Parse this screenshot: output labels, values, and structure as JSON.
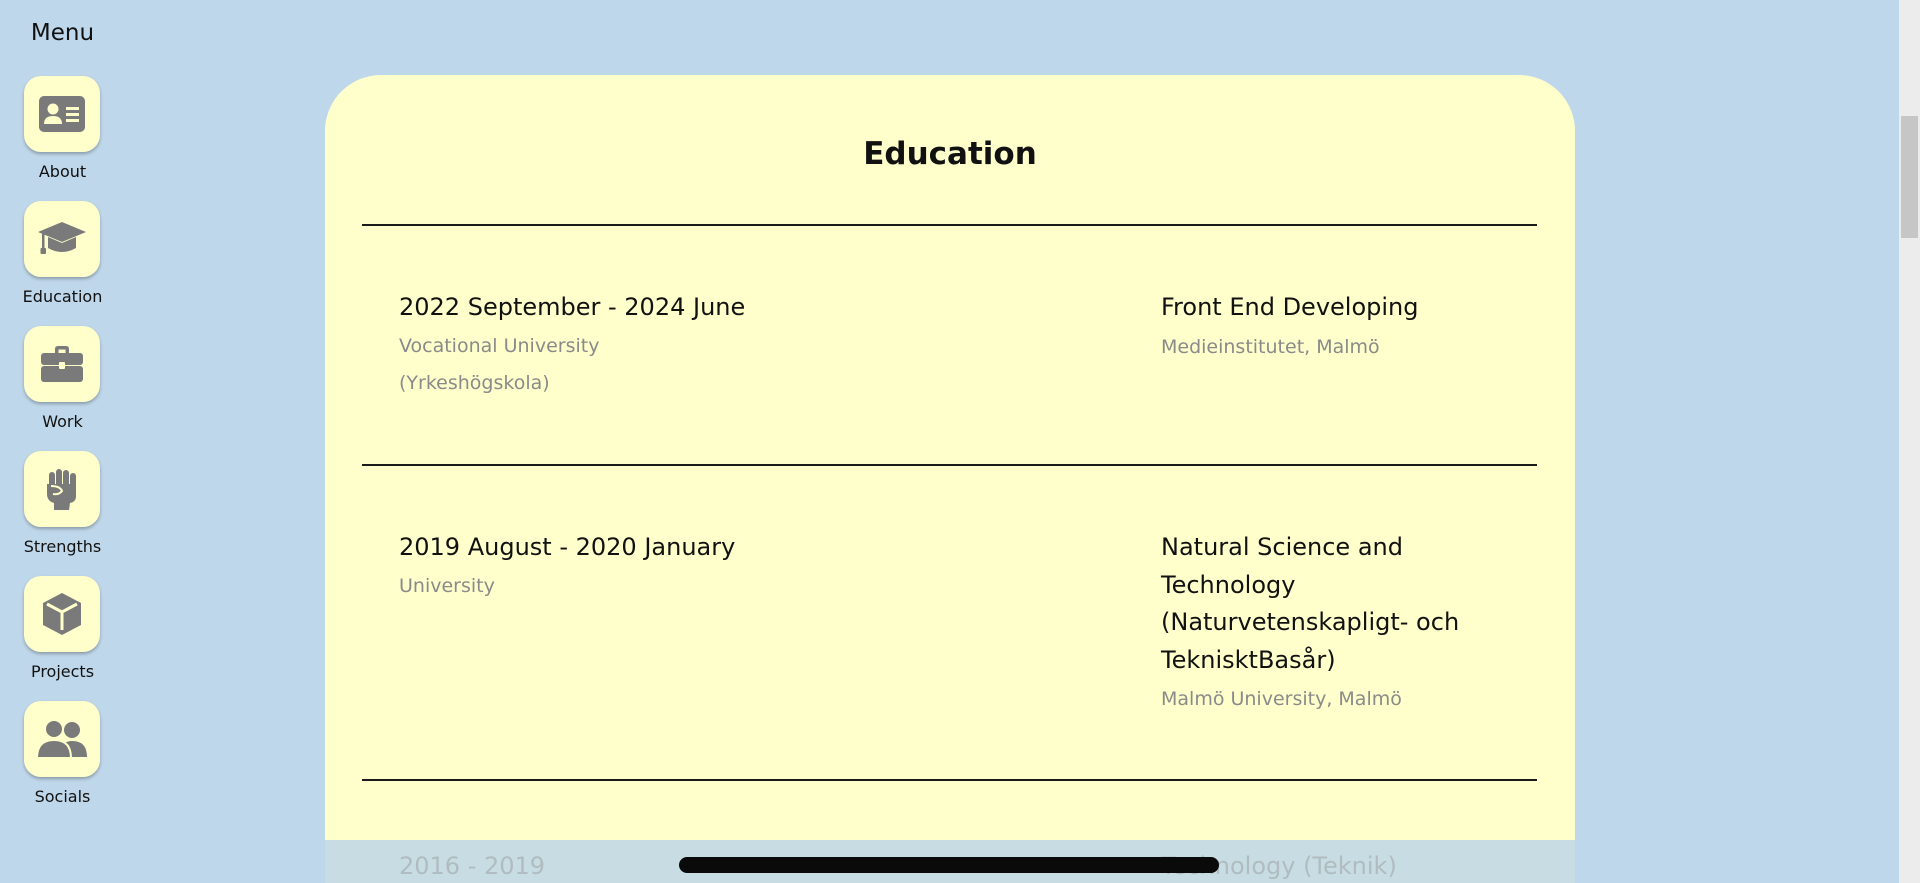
{
  "sidebar": {
    "title": "Menu",
    "items": [
      {
        "label": "About",
        "icon": "id-card-icon"
      },
      {
        "label": "Education",
        "icon": "graduation-cap-icon"
      },
      {
        "label": "Work",
        "icon": "briefcase-icon"
      },
      {
        "label": "Strengths",
        "icon": "fist-icon"
      },
      {
        "label": "Projects",
        "icon": "cube-icon"
      },
      {
        "label": "Socials",
        "icon": "users-icon"
      }
    ]
  },
  "main": {
    "title": "Education",
    "entries": [
      {
        "date": "2022 September - 2024 June",
        "type_lines": [
          "Vocational University",
          "(Yrkeshögskola)"
        ],
        "program_lines": [
          "Front End Developing"
        ],
        "school": "Medieinstitutet, Malmö"
      },
      {
        "date": "2019 August - 2020 January",
        "type_lines": [
          "University"
        ],
        "program_lines": [
          "Natural Science and",
          "Technology",
          "(Naturvetenskapligt- och",
          "TeknisktBasår)"
        ],
        "school": "Malmö University, Malmö"
      },
      {
        "date": "2016 - 2019",
        "program_lines": [
          "Technology (Teknik)"
        ]
      }
    ]
  },
  "colors": {
    "background": "#bfd7ea",
    "card": "#ffffcc",
    "icon": "#7a7a7a",
    "text": "#111111",
    "muted": "#8a8a8a"
  }
}
